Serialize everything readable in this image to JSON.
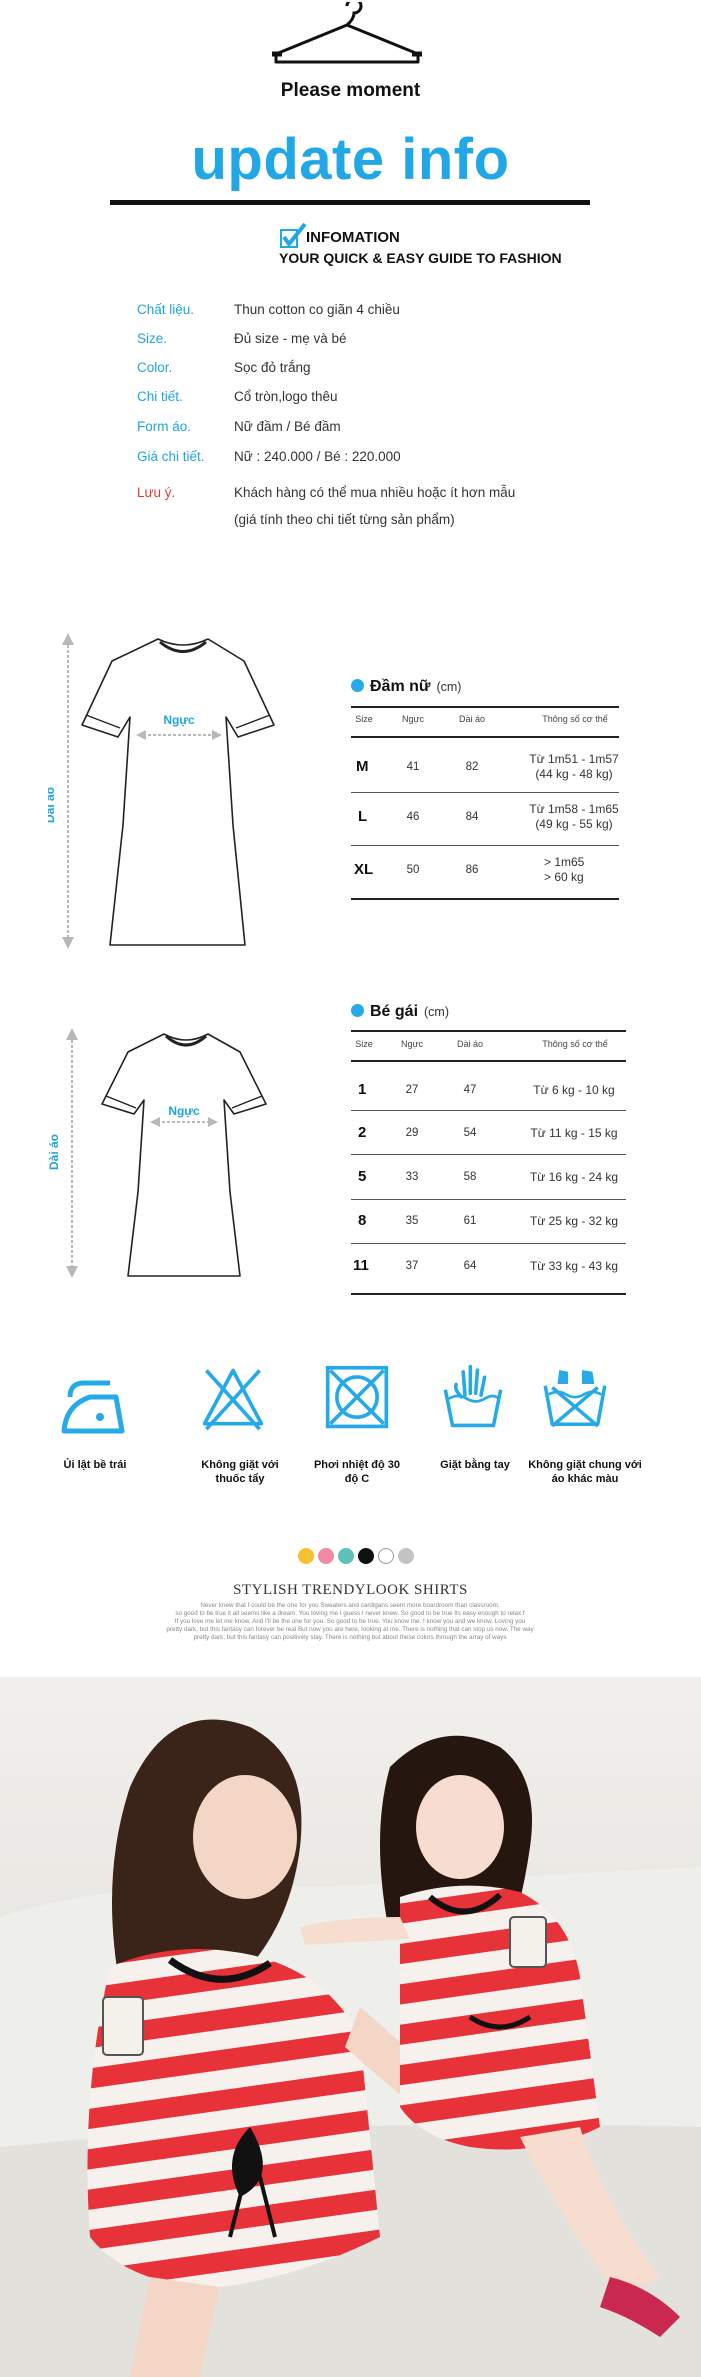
{
  "header": {
    "please_text": "Please moment",
    "title": "update info",
    "info_heading": "INFOMATION",
    "guide_line": "YOUR QUICK & EASY GUIDE TO FASHION",
    "accent_color": "#22a7e6"
  },
  "info": [
    {
      "label": "Chất liệu.",
      "value": "Thun cotton co giãn 4 chiều"
    },
    {
      "label": "Size.",
      "value": "Đủ size - mẹ và bé"
    },
    {
      "label": "Color.",
      "value": "Sọc đỏ trắng"
    },
    {
      "label": "Chi tiết.",
      "value": "Cổ tròn,logo thêu"
    },
    {
      "label": "Form áo.",
      "value": "Nữ đầm / Bé đầm"
    },
    {
      "label": "Giá chi tiết.",
      "value": "Nữ : 240.000 / Bé : 220.000"
    },
    {
      "label": "Lưu ý.",
      "value": "Khách hàng có thể mua nhiều hoặc ít hơn mẫu",
      "value2": "(giá tính theo chi tiết từng sản phẩm)"
    }
  ],
  "diagram_women": {
    "chest": "Ngực",
    "length": "Dài áo"
  },
  "diagram_kids": {
    "chest": "Ngực",
    "length": "Dài áo"
  },
  "table_women": {
    "title": "Đầm nữ",
    "unit": "(cm)",
    "headers": [
      "Size",
      "Ngực",
      "Dài áo",
      "Thông số cơ thể"
    ],
    "rows": [
      {
        "size": "M",
        "chest": "41",
        "length": "82",
        "spec1": "Từ  1m51 - 1m57",
        "spec2": "(44 kg - 48 kg)"
      },
      {
        "size": "L",
        "chest": "46",
        "length": "84",
        "spec1": "Từ  1m58 - 1m65",
        "spec2": "(49 kg - 55 kg)"
      },
      {
        "size": "XL",
        "chest": "50",
        "length": "86",
        "spec1": "> 1m65",
        "spec2": "> 60 kg"
      }
    ]
  },
  "table_kids": {
    "title": "Bé gái",
    "unit": "(cm)",
    "headers": [
      "Size",
      "Ngực",
      "Dài áo",
      "Thông số cơ thể"
    ],
    "rows": [
      {
        "size": "1",
        "chest": "27",
        "length": "47",
        "spec": "Từ 6 kg - 10 kg"
      },
      {
        "size": "2",
        "chest": "29",
        "length": "54",
        "spec": "Từ  11 kg - 15 kg"
      },
      {
        "size": "5",
        "chest": "33",
        "length": "58",
        "spec": "Từ  16 kg - 24 kg"
      },
      {
        "size": "8",
        "chest": "35",
        "length": "61",
        "spec": "Từ 25 kg - 32 kg"
      },
      {
        "size": "11",
        "chest": "37",
        "length": "64",
        "spec": "Từ 33 kg - 43 kg"
      }
    ]
  },
  "care": [
    {
      "icon": "iron-icon",
      "label": "Ủi lật bề trái"
    },
    {
      "icon": "no-bleach-icon",
      "label": "Không giặt với thuốc tẩy"
    },
    {
      "icon": "tumble-dry-icon",
      "label": "Phơi nhiệt độ 30 độ C"
    },
    {
      "icon": "hand-wash-icon",
      "label": "Giặt bằng tay"
    },
    {
      "icon": "no-wash-together-icon",
      "label": "Không giặt chung với áo khác màu"
    }
  ],
  "swatches": [
    "#f5c12e",
    "#f08aa5",
    "#5ec2b8",
    "#111111",
    "#ffffff",
    "#c4c4c4"
  ],
  "brand": {
    "headline": "STYLISH TRENDYLOOK SHIRTS",
    "tagline1": "Never knew that I could be the one for you Sweaters and cardigans seem more boardroom than classroom.",
    "tagline2": "so good to be true it all seems like a dream. You loving me I guess I never knew. So good to be true Its easy enough to relax f",
    "tagline3": "If you love me let me know. And I'll be the one for you. So good to be true. You know me. I know you and we know. Loving you",
    "tagline4": "pretty dark, but this fantasy can forever be real But now you are here, looking at me. There is nothing that can stop us now. The way",
    "tagline5": "pretty dark, but this fantasy can positively stay. There is nothing but about these colors through the array of ways"
  }
}
